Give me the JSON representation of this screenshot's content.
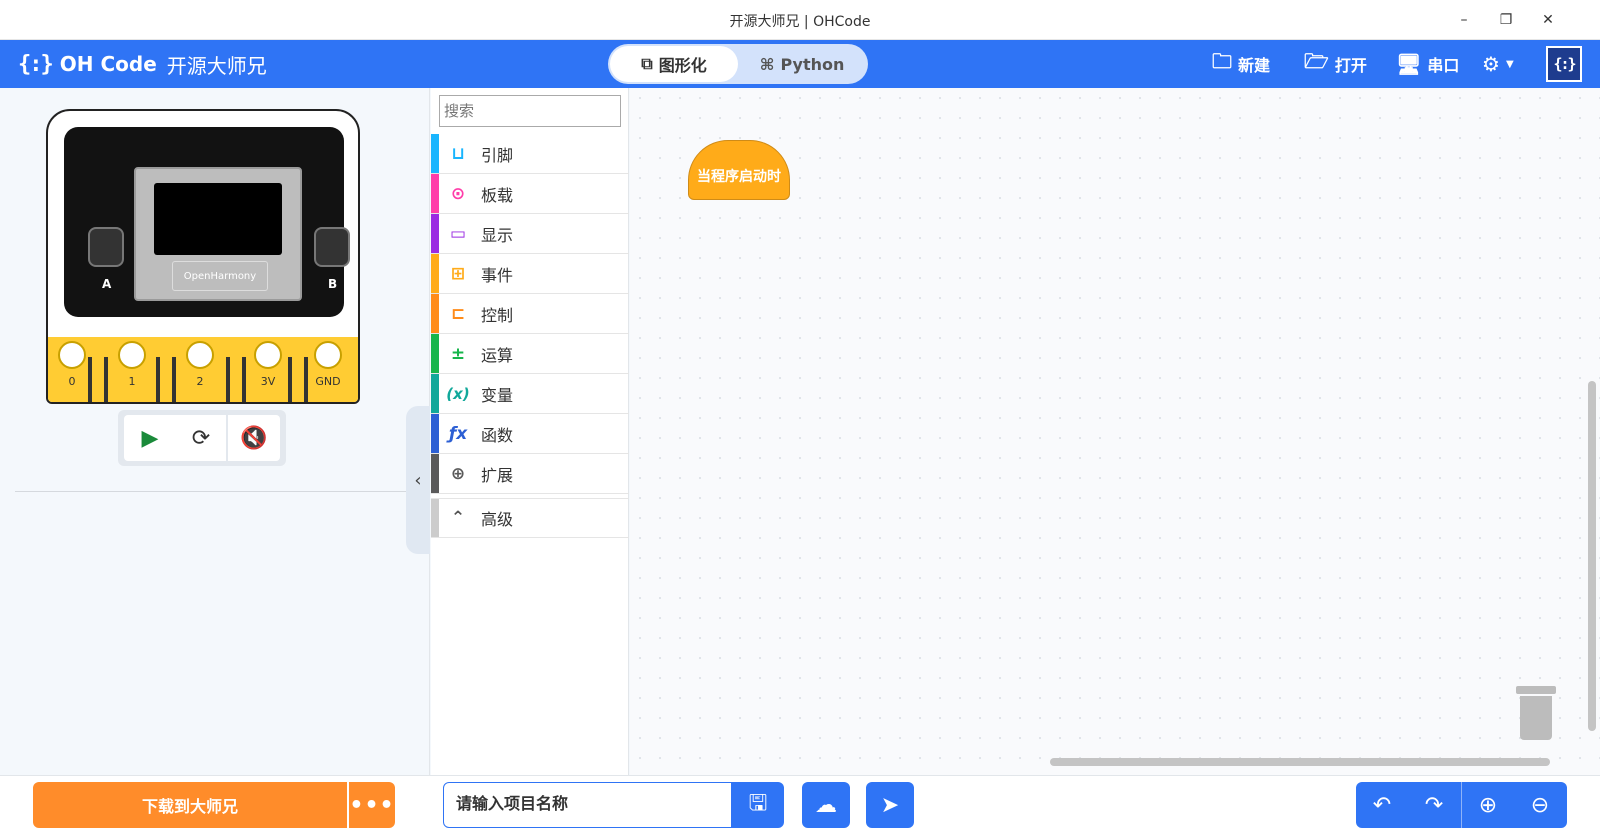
{
  "window": {
    "title": "开源大师兄 | OHCode",
    "minimize": "–",
    "restore": "❐",
    "close": "✕"
  },
  "header": {
    "logo_face": "{:}",
    "logo_name": "OH Code",
    "logo_cn": "开源大师兄",
    "modes": [
      {
        "label": "图形化",
        "icon": "puzzle-icon",
        "active": true
      },
      {
        "label": "Python",
        "icon": "python-icon",
        "active": false
      }
    ],
    "actions": [
      {
        "label": "新建",
        "icon": "new-folder-icon"
      },
      {
        "label": "打开",
        "icon": "open-folder-icon"
      },
      {
        "label": "串口",
        "icon": "serial-port-icon"
      }
    ],
    "settings_icon": "gear-icon",
    "avatar_text": "{:}"
  },
  "simulator": {
    "screen_label": "OpenHarmony",
    "button_a": "A",
    "button_b": "B",
    "pins": [
      "0",
      "1",
      "2",
      "3V",
      "GND"
    ],
    "controls": [
      {
        "name": "play",
        "icon": "play-icon"
      },
      {
        "name": "refresh",
        "icon": "refresh-icon"
      },
      {
        "name": "mute",
        "icon": "mute-icon"
      }
    ]
  },
  "categories": {
    "search_placeholder": "搜索",
    "items": [
      {
        "label": "引脚",
        "color": "#19b5fe",
        "icon": "pin-icon"
      },
      {
        "label": "板载",
        "color": "#ff3da9",
        "icon": "board-icon"
      },
      {
        "label": "显示",
        "color": "#9a2be2",
        "icon": "display-icon"
      },
      {
        "label": "事件",
        "color": "#ffab19",
        "icon": "event-icon"
      },
      {
        "label": "控制",
        "color": "#ff8c1a",
        "icon": "control-icon"
      },
      {
        "label": "运算",
        "color": "#17b54b",
        "icon": "operator-icon"
      },
      {
        "label": "变量",
        "color": "#11a89a",
        "icon": "variable-icon"
      },
      {
        "label": "函数",
        "color": "#2c5fd4",
        "icon": "function-icon"
      },
      {
        "label": "扩展",
        "color": "#5a5a5a",
        "icon": "extension-icon"
      }
    ],
    "advanced_label": "高级"
  },
  "workspace": {
    "hat_block_label": "当程序启动时"
  },
  "bottom": {
    "download_label": "下载到大师兄",
    "more_label": "•••",
    "project_placeholder": "请输入项目名称"
  },
  "colors": {
    "primary": "#2f74f5",
    "accent_orange": "#ff8c2a",
    "event_block": "#ffab19"
  }
}
